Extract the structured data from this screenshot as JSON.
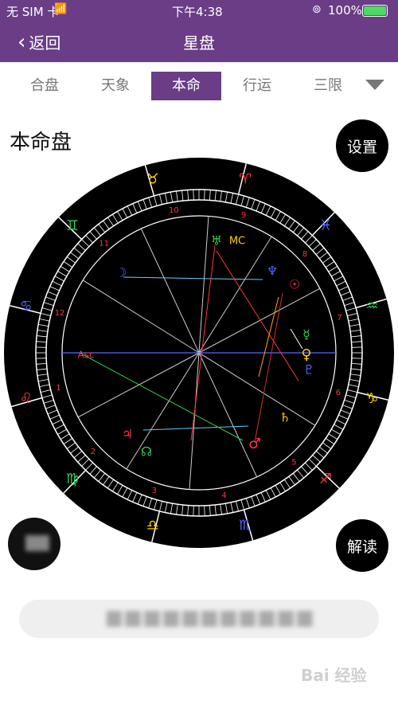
{
  "status": {
    "carrier": "无 SIM 卡",
    "time": "下午4:38",
    "battery": "100%"
  },
  "nav": {
    "back_label": "返回",
    "title": "星盘"
  },
  "tabs": [
    {
      "label": "合盘",
      "active": false
    },
    {
      "label": "天象",
      "active": false
    },
    {
      "label": "本命",
      "active": true
    },
    {
      "label": "行运",
      "active": false
    },
    {
      "label": "三限",
      "active": false
    }
  ],
  "section_title": "本命盘",
  "buttons": {
    "settings": "设置",
    "interpret": "解读"
  },
  "chart": {
    "house_numbers": [
      "1",
      "2",
      "3",
      "4",
      "5",
      "6",
      "7",
      "8",
      "9",
      "10",
      "11",
      "12"
    ],
    "ascendant_label": "Asc",
    "midheaven_label": "MC",
    "zodiac_signs": [
      "♈",
      "♉",
      "♊",
      "♋",
      "♌",
      "♍",
      "♎",
      "♏",
      "♐",
      "♑",
      "♒",
      "♓"
    ],
    "planet_glyphs": [
      "☉",
      "☽",
      "☿",
      "♀",
      "♂",
      "♃",
      "♄",
      "♅",
      "♆",
      "♇",
      "☊"
    ]
  },
  "watermark": "Bai 经验",
  "colors": {
    "accent": "#6a3d86",
    "chart_bg": "#000000"
  }
}
